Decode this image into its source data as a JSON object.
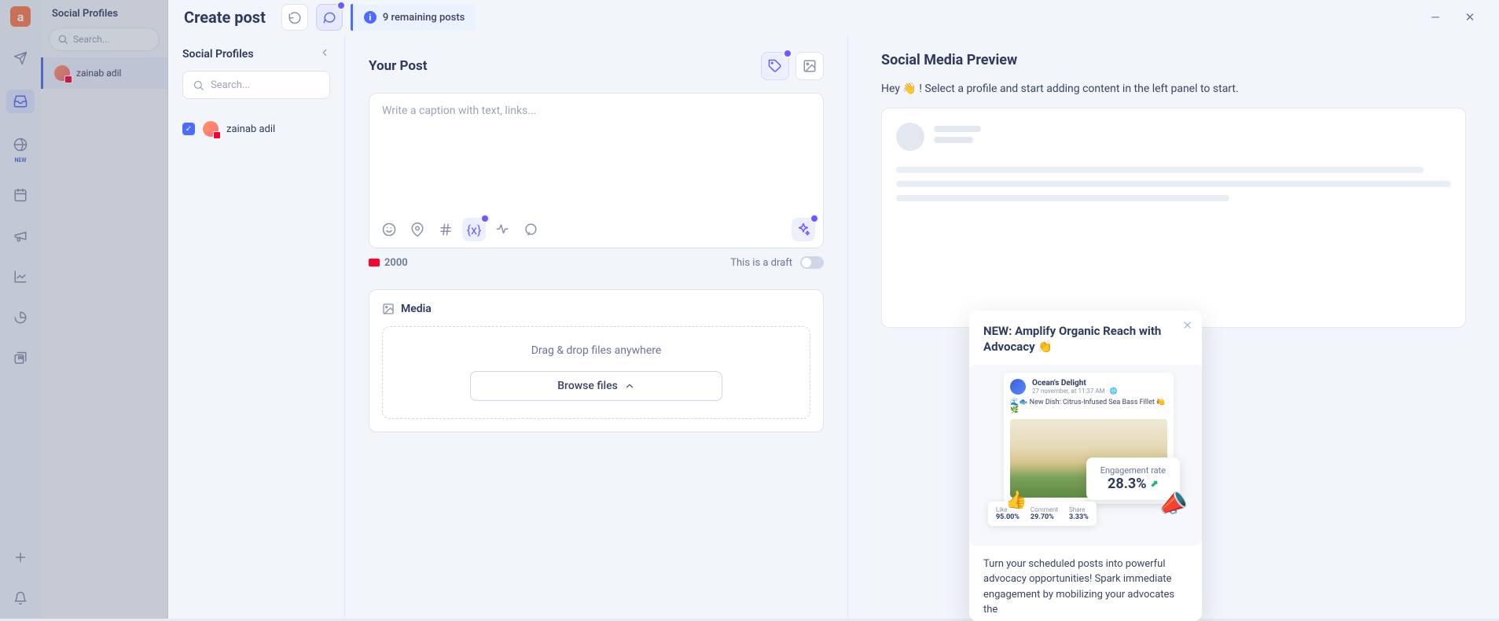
{
  "backPanel": {
    "title": "Social Profiles",
    "searchPlaceholder": "Search...",
    "profileName": "zainab adil",
    "newBadge": "NEW"
  },
  "header": {
    "title": "Create post",
    "remaining": "9 remaining posts"
  },
  "profiles": {
    "title": "Social Profiles",
    "searchPlaceholder": "Search...",
    "item": "zainab adil"
  },
  "compose": {
    "title": "Your Post",
    "placeholder": "Write a caption with text, links...",
    "charLimit": "2000",
    "draftLabel": "This is a draft",
    "mediaTitle": "Media",
    "dropText": "Drag & drop files anywhere",
    "browse": "Browse files"
  },
  "preview": {
    "title": "Social Media Preview",
    "hint": "Hey 👋 ! Select a profile and start adding content in the left panel to start."
  },
  "popup": {
    "title": "NEW: Amplify Organic Reach with Advocacy 👏",
    "promo": {
      "name": "Ocean's Delight",
      "sub": "27 november, at 11:37 AM · 🌐",
      "caption": "🌊🐟 New Dish: Citrus-Infused Sea Bass Fillet 🍋🌿",
      "engLabel": "Engagement rate",
      "engValue": "28.3%",
      "stats": {
        "like": {
          "l": "Like",
          "v": "95.00%"
        },
        "comment": {
          "l": "Comment",
          "v": "29.70%"
        },
        "share": {
          "l": "Share",
          "v": "3.33%"
        }
      }
    },
    "desc": "Turn your scheduled posts into powerful advocacy opportunities! Spark immediate engagement by mobilizing your advocates the"
  }
}
